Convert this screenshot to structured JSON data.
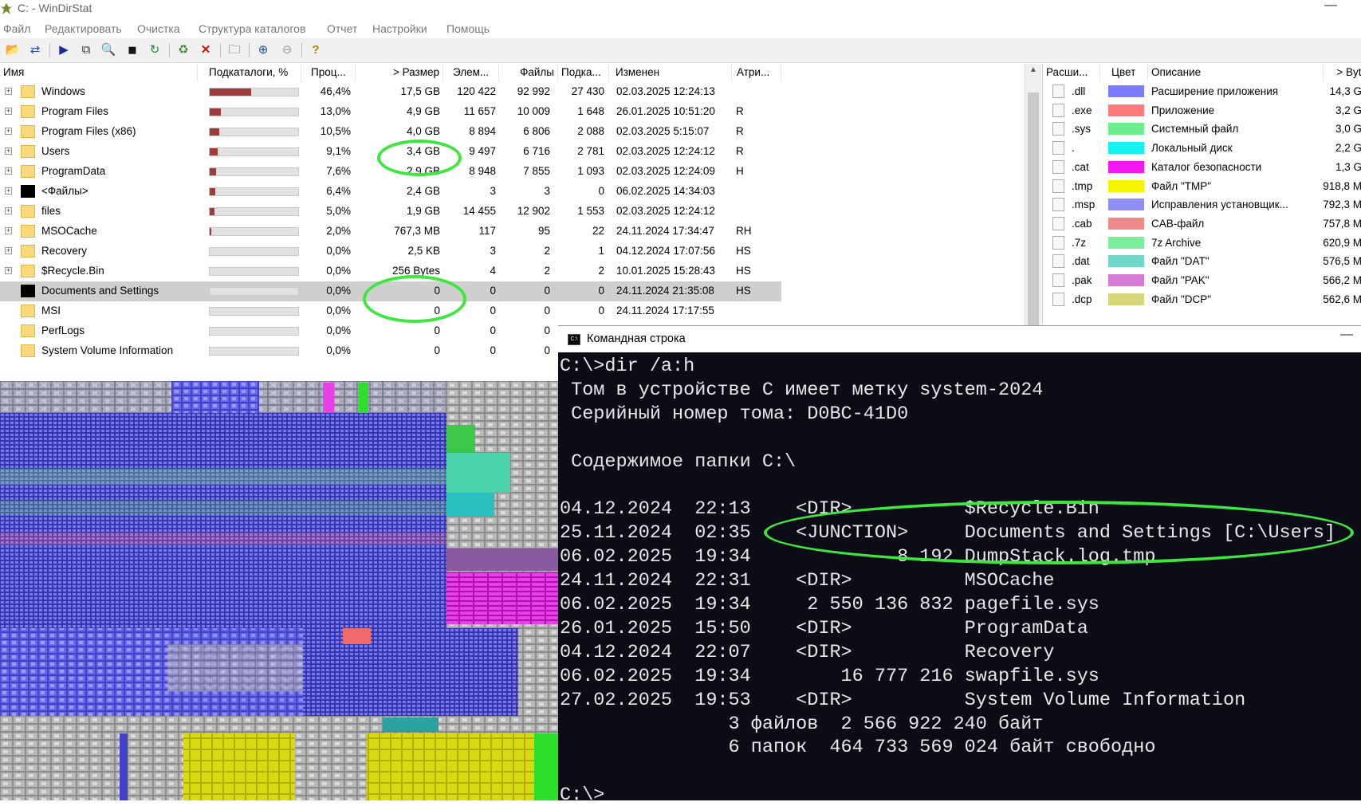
{
  "window": {
    "title": "C: - WinDirStat"
  },
  "menu": [
    "Файл",
    "Редактировать",
    "Очистка",
    "Структура каталогов",
    "Отчет",
    "Настройки",
    "Помощь"
  ],
  "toolbar_icons": [
    "open-icon",
    "refresh-icon",
    "play-icon",
    "copy-icon",
    "explorer-icon",
    "cmd-icon",
    "refresh-all-icon",
    "recycle-icon",
    "delete-icon",
    "new-folder-icon",
    "zoom-in-icon",
    "zoom-out-icon",
    "help-icon"
  ],
  "tree": {
    "headers": [
      "Имя",
      "Подкаталоги, %",
      "Проц...",
      "> Размер",
      "Элем...",
      "Файлы",
      "Подка...",
      "Изменен",
      "Атри..."
    ],
    "rows": [
      {
        "name": "Windows",
        "pct": "46,4%",
        "size": "17,5 GB",
        "items": "120 422",
        "files": "92 992",
        "subdirs": "27 430",
        "modified": "02.03.2025  12:24:13",
        "attr": "",
        "bar": 0.464,
        "expand": true,
        "icon": "folder"
      },
      {
        "name": "Program Files",
        "pct": "13,0%",
        "size": "4,9 GB",
        "items": "11 657",
        "files": "10 009",
        "subdirs": "1 648",
        "modified": "26.01.2025  10:51:20",
        "attr": "R",
        "bar": 0.13,
        "expand": true,
        "icon": "folder"
      },
      {
        "name": "Program Files (x86)",
        "pct": "10,5%",
        "size": "4,0 GB",
        "items": "8 894",
        "files": "6 806",
        "subdirs": "2 088",
        "modified": "02.03.2025  5:15:07",
        "attr": "R",
        "bar": 0.105,
        "expand": true,
        "icon": "folder"
      },
      {
        "name": "Users",
        "pct": "9,1%",
        "size": "3,4 GB",
        "items": "9 497",
        "files": "6 716",
        "subdirs": "2 781",
        "modified": "02.03.2025  12:24:12",
        "attr": "R",
        "bar": 0.091,
        "expand": true,
        "icon": "folder"
      },
      {
        "name": "ProgramData",
        "pct": "7,6%",
        "size": "2,9 GB",
        "items": "8 948",
        "files": "7 855",
        "subdirs": "1 093",
        "modified": "02.03.2025  12:24:09",
        "attr": "H",
        "bar": 0.076,
        "expand": true,
        "icon": "folder"
      },
      {
        "name": "<Файлы>",
        "pct": "6,4%",
        "size": "2,4 GB",
        "items": "3",
        "files": "3",
        "subdirs": "0",
        "modified": "06.02.2025  14:34:03",
        "attr": "",
        "bar": 0.064,
        "expand": true,
        "icon": "black"
      },
      {
        "name": "files",
        "pct": "5,0%",
        "size": "1,9 GB",
        "items": "14 455",
        "files": "12 902",
        "subdirs": "1 553",
        "modified": "02.03.2025  12:24:12",
        "attr": "",
        "bar": 0.05,
        "expand": true,
        "icon": "folder"
      },
      {
        "name": "MSOCache",
        "pct": "2,0%",
        "size": "767,3 MB",
        "items": "117",
        "files": "95",
        "subdirs": "22",
        "modified": "24.11.2024  17:34:47",
        "attr": "RH",
        "bar": 0.02,
        "expand": true,
        "icon": "folder"
      },
      {
        "name": "Recovery",
        "pct": "0,0%",
        "size": "2,5 KB",
        "items": "3",
        "files": "2",
        "subdirs": "1",
        "modified": "04.12.2024  17:07:56",
        "attr": "HS",
        "bar": 0,
        "expand": true,
        "icon": "folder"
      },
      {
        "name": "$Recycle.Bin",
        "pct": "0,0%",
        "size": "256 Bytes",
        "items": "4",
        "files": "2",
        "subdirs": "2",
        "modified": "10.01.2025  15:28:43",
        "attr": "HS",
        "bar": 0,
        "expand": true,
        "icon": "folder"
      },
      {
        "name": "Documents and Settings",
        "pct": "0,0%",
        "size": "0",
        "items": "0",
        "files": "0",
        "subdirs": "0",
        "modified": "24.11.2024  21:35:08",
        "attr": "HS",
        "bar": 0,
        "expand": false,
        "icon": "black",
        "selected": true
      },
      {
        "name": "MSI",
        "pct": "0,0%",
        "size": "0",
        "items": "0",
        "files": "0",
        "subdirs": "0",
        "modified": "24.11.2024  17:17:55",
        "attr": "",
        "bar": 0,
        "expand": false,
        "icon": "folder"
      },
      {
        "name": "PerfLogs",
        "pct": "0,0%",
        "size": "0",
        "items": "0",
        "files": "0",
        "subdirs": "",
        "modified": "",
        "attr": "",
        "bar": 0,
        "expand": false,
        "icon": "folder"
      },
      {
        "name": "System Volume Information",
        "pct": "0,0%",
        "size": "0",
        "items": "0",
        "files": "0",
        "subdirs": "",
        "modified": "",
        "attr": "",
        "bar": 0,
        "expand": false,
        "icon": "folder"
      }
    ]
  },
  "extensions": {
    "headers": [
      "Расши...",
      "Цвет",
      "Описание",
      "> Byte"
    ],
    "rows": [
      {
        "ext": ".dll",
        "color": "#7b7bff",
        "desc": "Расширение приложения",
        "size": "14,3 G"
      },
      {
        "ext": ".exe",
        "color": "#ff7b7b",
        "desc": "Приложение",
        "size": "3,2 G"
      },
      {
        "ext": ".sys",
        "color": "#6bee8b",
        "desc": "Системный файл",
        "size": "3,0 G"
      },
      {
        "ext": ".",
        "color": "#15f0f0",
        "desc": "Локальный диск",
        "size": "2,2 G"
      },
      {
        "ext": ".cat",
        "color": "#f517f0",
        "desc": "Каталог безопасности",
        "size": "1,3 G"
      },
      {
        "ext": ".tmp",
        "color": "#f5f500",
        "desc": "Файл \"TMP\"",
        "size": "918,8 M"
      },
      {
        "ext": ".msp",
        "color": "#8f8ff5",
        "desc": "Исправления установщик...",
        "size": "792,3 M"
      },
      {
        "ext": ".cab",
        "color": "#f08a8a",
        "desc": "CAB-файл",
        "size": "757,8 M"
      },
      {
        "ext": ".7z",
        "color": "#7bee9b",
        "desc": "7z Archive",
        "size": "620,9 M"
      },
      {
        "ext": ".dat",
        "color": "#6fd6c8",
        "desc": "Файл \"DAT\"",
        "size": "576,5 M"
      },
      {
        "ext": ".pak",
        "color": "#d67bd6",
        "desc": "Файл \"PAK\"",
        "size": "566,2 M"
      },
      {
        "ext": ".dcp",
        "color": "#d6d67b",
        "desc": "Файл \"DCP\"",
        "size": "562,6 M"
      }
    ]
  },
  "cmd": {
    "title": "Командная строка",
    "lines": [
      "C:\\>dir /a:h",
      " Том в устройстве C имеет метку system-2024",
      " Серийный номер тома: D0BC-41D0",
      "",
      " Содержимое папки C:\\",
      "",
      "04.12.2024  22:13    <DIR>          $Recycle.Bin",
      "25.11.2024  02:35    <JUNCTION>     Documents and Settings [C:\\Users]",
      "06.02.2025  19:34             8 192 DumpStack.log.tmp",
      "24.11.2024  22:31    <DIR>          MSOCache",
      "06.02.2025  19:34     2 550 136 832 pagefile.sys",
      "26.01.2025  15:50    <DIR>          ProgramData",
      "04.12.2024  22:07    <DIR>          Recovery",
      "06.02.2025  19:34        16 777 216 swapfile.sys",
      "27.02.2025  19:53    <DIR>          System Volume Information",
      "               3 файлов  2 566 922 240 байт",
      "               6 папок  464 733 569 024 байт свободно",
      "",
      "C:\\>"
    ]
  }
}
